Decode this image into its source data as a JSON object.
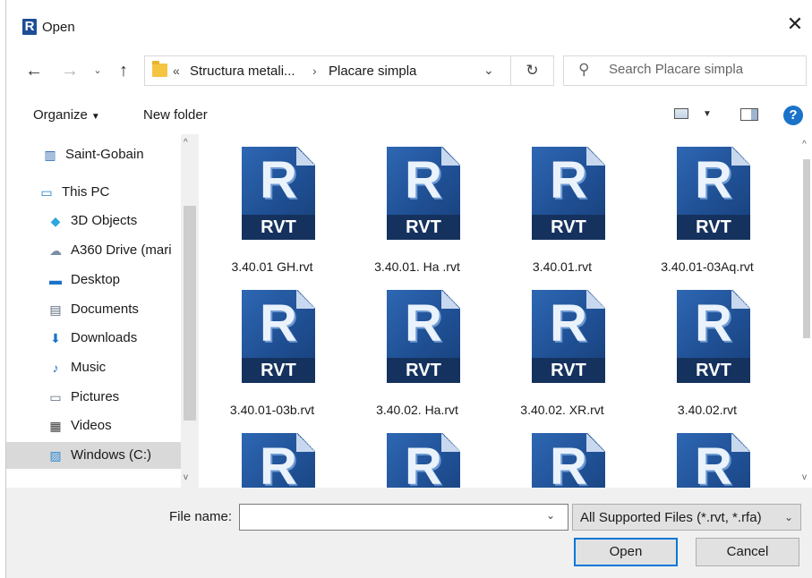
{
  "window": {
    "title": "Open",
    "app_icon": "R"
  },
  "nav": {
    "back_icon": "←",
    "forward_icon": "→",
    "recent_icon": "⌄",
    "up_icon": "↑",
    "breadcrumb_prefix": "«",
    "breadcrumb": [
      "Structura metali...",
      "Placare simpla"
    ],
    "breadcrumb_sep": "›",
    "address_dropdown": "⌄",
    "refresh_icon": "↻"
  },
  "search": {
    "placeholder": "Search Placare simpla"
  },
  "toolbar": {
    "organize": "Organize",
    "organize_caret": "▼",
    "new_folder": "New folder",
    "view_caret": "▼",
    "help": "?"
  },
  "sidebar": {
    "items": [
      {
        "label": "Saint-Gobain",
        "icon": "network-building-icon",
        "glyph": "▥",
        "color": "#1f5fa8"
      },
      {
        "label": "This PC",
        "icon": "computer-icon",
        "glyph": "▭",
        "color": "#1a7fd0"
      },
      {
        "label": "3D Objects",
        "icon": "cube-icon",
        "glyph": "◆",
        "color": "#2ca7e0"
      },
      {
        "label": "A360 Drive (mari",
        "icon": "cloud-drive-icon",
        "glyph": "☁",
        "color": "#7a8ea6"
      },
      {
        "label": "Desktop",
        "icon": "desktop-icon",
        "glyph": "▬",
        "color": "#1a73c9"
      },
      {
        "label": "Documents",
        "icon": "document-icon",
        "glyph": "▤",
        "color": "#5a6b7d"
      },
      {
        "label": "Downloads",
        "icon": "download-arrow-icon",
        "glyph": "⬇",
        "color": "#1a73c9"
      },
      {
        "label": "Music",
        "icon": "music-note-icon",
        "glyph": "♪",
        "color": "#1a73c9"
      },
      {
        "label": "Pictures",
        "icon": "pictures-icon",
        "glyph": "▭",
        "color": "#5a6b7d"
      },
      {
        "label": "Videos",
        "icon": "film-icon",
        "glyph": "▦",
        "color": "#3a3a3a"
      },
      {
        "label": "Windows (C:)",
        "icon": "drive-icon",
        "glyph": "▨",
        "color": "#2e8bd6"
      }
    ],
    "selected": "Windows (C:)"
  },
  "files": [
    {
      "name": "3.40.01 GH.rvt",
      "badge": "RVT",
      "letter": "R"
    },
    {
      "name": "3.40.01. Ha .rvt",
      "badge": "RVT",
      "letter": "R"
    },
    {
      "name": "3.40.01.rvt",
      "badge": "RVT",
      "letter": "R"
    },
    {
      "name": "3.40.01-03Aq.rvt",
      "badge": "RVT",
      "letter": "R"
    },
    {
      "name": "3.40.01-03b.rvt",
      "badge": "RVT",
      "letter": "R"
    },
    {
      "name": "3.40.02. Ha.rvt",
      "badge": "RVT",
      "letter": "R"
    },
    {
      "name": "3.40.02. XR.rvt",
      "badge": "RVT",
      "letter": "R"
    },
    {
      "name": "3.40.02.rvt",
      "badge": "RVT",
      "letter": "R"
    },
    {
      "name": "",
      "badge": "",
      "letter": "R"
    },
    {
      "name": "",
      "badge": "",
      "letter": "R"
    },
    {
      "name": "",
      "badge": "",
      "letter": "R"
    },
    {
      "name": "",
      "badge": "",
      "letter": "R"
    }
  ],
  "bottom": {
    "file_name_label": "File name:",
    "file_name_value": "",
    "file_type": "All Supported Files (*.rvt, *.rfa)",
    "open_label": "Open",
    "cancel_label": "Cancel",
    "dropdown_caret": "⌄"
  },
  "colors": {
    "accent": "#0078d7",
    "rvt_blue": "#1f4f93",
    "rvt_band": "#15325e",
    "selected_bg": "#d9d9d9"
  },
  "scroll": {
    "up": "▲",
    "down": "▼",
    "up_small": "^",
    "down_small": "v"
  }
}
